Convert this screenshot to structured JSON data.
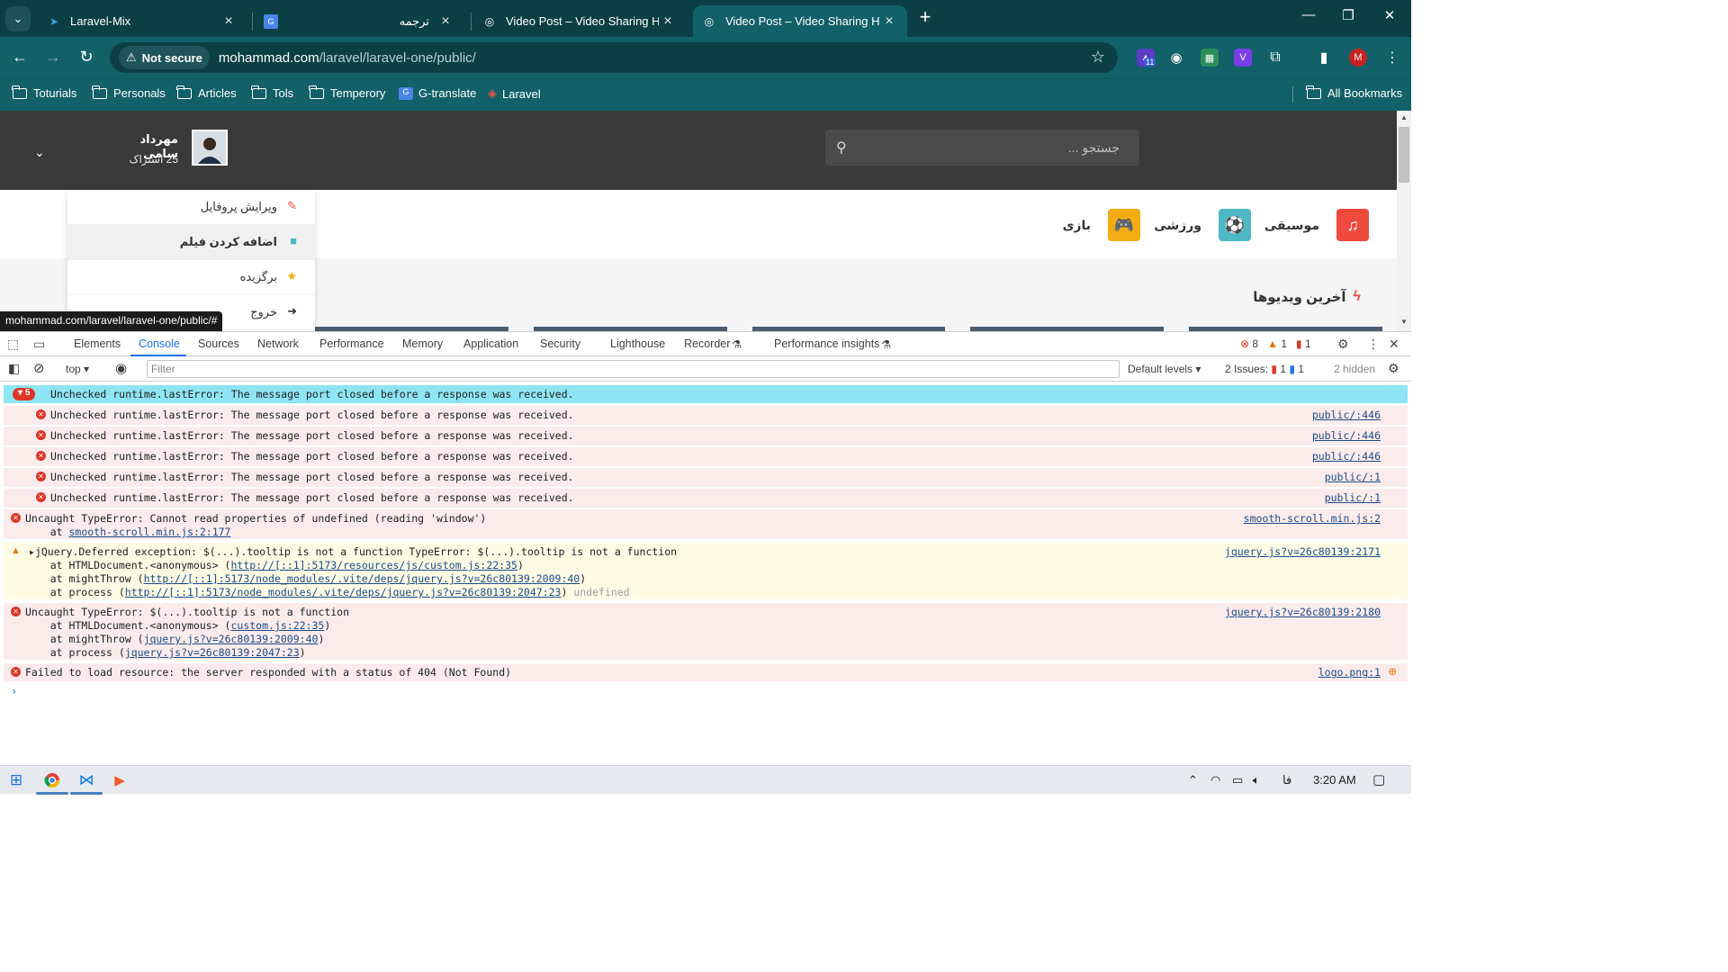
{
  "browser": {
    "tabs": [
      {
        "title": "Laravel-Mix",
        "favicon": "laravel-mix-icon",
        "active": false
      },
      {
        "title": "ترجمه",
        "favicon": "google-translate-icon",
        "active": false
      },
      {
        "title": "Video Post – Video Sharing HTML",
        "favicon": "globe-icon",
        "active": false
      },
      {
        "title": "Video Post – Video Sharing HTML",
        "favicon": "globe-icon",
        "active": true
      }
    ],
    "omnibox": {
      "security_label": "Not secure",
      "url_host": "mohammad.com",
      "url_path": "/laravel/laravel-one/public/"
    },
    "extension_badge": "11",
    "profile_initial": "M",
    "bookmarks": [
      "Toturials",
      "Personals",
      "Articles",
      "Tols",
      "Temperory",
      "G-translate",
      "Laravel"
    ],
    "all_bookmarks_label": "All Bookmarks"
  },
  "page": {
    "search_placeholder": "جستجو ...",
    "user": {
      "name": "مهرداد سامی",
      "subscribers": "25 اشتراک"
    },
    "categories": [
      {
        "label": "موسیقی",
        "color": "#ef4a3c",
        "icon": "music-icon"
      },
      {
        "label": "ورزشی",
        "color": "#4eb9c4",
        "icon": "football-icon"
      },
      {
        "label": "بازی",
        "color": "#f3ac12",
        "icon": "gamepad-icon"
      }
    ],
    "latest_videos_title": "آخرین ویدیوها",
    "dropdown": [
      {
        "label": "ویرایش پروفایل",
        "icon": "edit-icon"
      },
      {
        "label": "اضافه کردن فیلم",
        "icon": "video-camera-icon"
      },
      {
        "label": "برگزیده",
        "icon": "star-icon"
      },
      {
        "label": "خروج",
        "icon": "logout-icon"
      }
    ],
    "status_url": "mohammad.com/laravel/laravel-one/public/#"
  },
  "devtools": {
    "tabs": [
      "Elements",
      "Console",
      "Sources",
      "Network",
      "Performance",
      "Memory",
      "Application",
      "Security",
      "Lighthouse",
      "Recorder",
      "Performance insights"
    ],
    "active_tab": "Console",
    "counts": {
      "errors": "8",
      "warnings": "1",
      "issues": "1"
    },
    "context": "top",
    "filter_placeholder": "Filter",
    "levels": "Default levels",
    "issues_label": "2 Issues:",
    "issues_err": "1",
    "issues_info": "1",
    "hidden": "2 hidden",
    "group": {
      "count": "5",
      "message": "Unchecked runtime.lastError: The message port closed before a response was received."
    },
    "grouped_messages": [
      {
        "message": "Unchecked runtime.lastError: The message port closed before a response was received.",
        "source": "public/:446"
      },
      {
        "message": "Unchecked runtime.lastError: The message port closed before a response was received.",
        "source": "public/:446"
      },
      {
        "message": "Unchecked runtime.lastError: The message port closed before a response was received.",
        "source": "public/:446"
      },
      {
        "message": "Unchecked runtime.lastError: The message port closed before a response was received.",
        "source": "public/:1"
      },
      {
        "message": "Unchecked runtime.lastError: The message port closed before a response was received.",
        "source": "public/:1"
      }
    ],
    "error1": {
      "message": "Uncaught TypeError: Cannot read properties of undefined (reading 'window')",
      "at": "    at ",
      "at_link": "smooth-scroll.min.js:2:177",
      "source": "smooth-scroll.min.js:2"
    },
    "warning": {
      "message": "jQuery.Deferred exception: $(...).tooltip is not a function TypeError: $(...).tooltip is not a function",
      "source": "jquery.js?v=26c80139:2171",
      "l1a": "    at HTMLDocument.<anonymous> (",
      "l1link": "http://[::1]:5173/resources/js/custom.js:22:35",
      "l1b": ")",
      "l2a": "    at mightThrow (",
      "l2link": "http://[::1]:5173/node_modules/.vite/deps/jquery.js?v=26c80139:2009:40",
      "l2b": ")",
      "l3a": "    at process (",
      "l3link": "http://[::1]:5173/node_modules/.vite/deps/jquery.js?v=26c80139:2047:23",
      "l3b": ") ",
      "l3dim": "undefined"
    },
    "error2": {
      "message": "Uncaught TypeError: $(...).tooltip is not a function",
      "source": "jquery.js?v=26c80139:2180",
      "l1a": "    at HTMLDocument.<anonymous> (",
      "l1link": "custom.js:22:35",
      "l1b": ")",
      "l2a": "    at mightThrow (",
      "l2link": "jquery.js?v=26c80139:2009:40",
      "l2b": ")",
      "l3a": "    at process (",
      "l3link": "jquery.js?v=26c80139:2047:23",
      "l3b": ")"
    },
    "error3": {
      "message": "Failed to load resource: the server responded with a status of 404 (Not Found)",
      "source": "logo.png:1"
    }
  },
  "taskbar": {
    "lang": "فا",
    "time": "3:20 AM"
  }
}
